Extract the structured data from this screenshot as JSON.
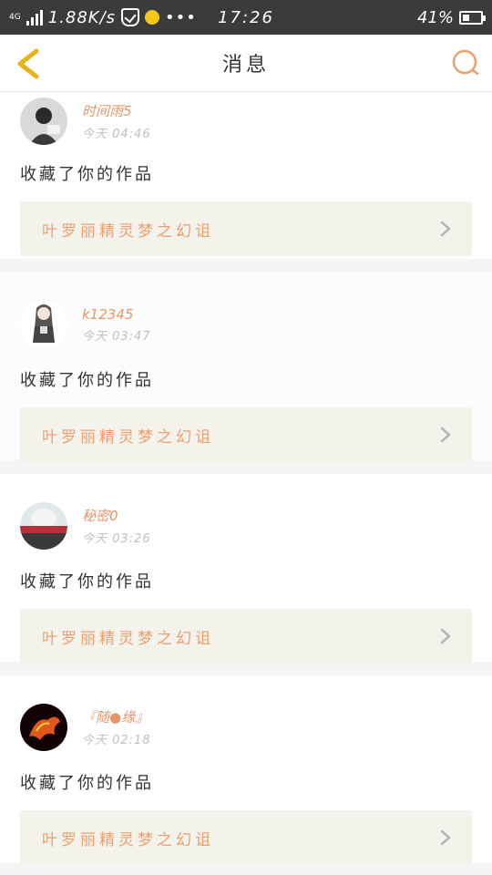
{
  "status_bar": {
    "network": "4G",
    "speed": "1.88K/s",
    "time": "17:26",
    "battery": "41%",
    "battery_level": 0.41,
    "more": "•••"
  },
  "header": {
    "title": "消息",
    "back_icon": "chevron-left-icon",
    "search_icon": "search-icon"
  },
  "colors": {
    "accent": "#e8956a",
    "back_icon": "#e9b21b",
    "work_bg": "#f3f3ec",
    "divider": "#f5f5f5"
  },
  "notifications": [
    {
      "user": "时间雨5",
      "time": "今天 04:46",
      "action": "收藏了你的作品",
      "work_title": "叶罗丽精灵梦之幻诅"
    },
    {
      "user": "k12345",
      "time": "今天 03:47",
      "action": "收藏了你的作品",
      "work_title": "叶罗丽精灵梦之幻诅"
    },
    {
      "user": "秘密0",
      "time": "今天 03:26",
      "action": "收藏了你的作品",
      "work_title": "叶罗丽精灵梦之幻诅"
    },
    {
      "user": "『随●缘』",
      "time": "今天 02:18",
      "action": "收藏了你的作品",
      "work_title": "叶罗丽精灵梦之幻诅"
    }
  ]
}
